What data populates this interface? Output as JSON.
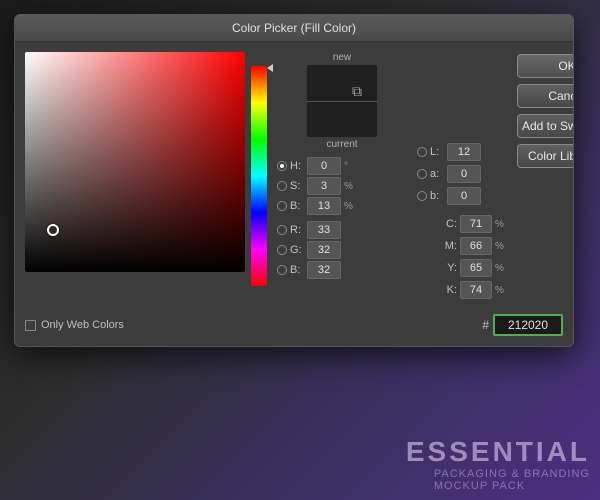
{
  "dialog": {
    "title": "Color Picker (Fill Color)",
    "ok_label": "OK",
    "cancel_label": "Cancel",
    "add_to_swatches_label": "Add to Swatches",
    "color_libraries_label": "Color Libraries"
  },
  "preview": {
    "new_label": "new",
    "current_label": "current",
    "new_color": "#212020",
    "current_color": "#212020"
  },
  "fields": {
    "H": {
      "value": "0",
      "unit": "°",
      "active": true
    },
    "S": {
      "value": "3",
      "unit": "%"
    },
    "B": {
      "value": "13",
      "unit": "%"
    },
    "R": {
      "value": "33",
      "unit": ""
    },
    "G": {
      "value": "32",
      "unit": ""
    },
    "B2": {
      "value": "32",
      "unit": ""
    },
    "L": {
      "value": "12",
      "unit": ""
    },
    "a": {
      "value": "0",
      "unit": ""
    },
    "b": {
      "value": "0",
      "unit": ""
    }
  },
  "cmyk": {
    "C": {
      "value": "71",
      "unit": "%"
    },
    "M": {
      "value": "66",
      "unit": "%"
    },
    "Y": {
      "value": "65",
      "unit": "%"
    },
    "K": {
      "value": "74",
      "unit": "%"
    }
  },
  "hex": {
    "hash": "#",
    "value": "212020"
  },
  "only_web_colors": {
    "label": "Only Web Colors",
    "checked": false
  }
}
